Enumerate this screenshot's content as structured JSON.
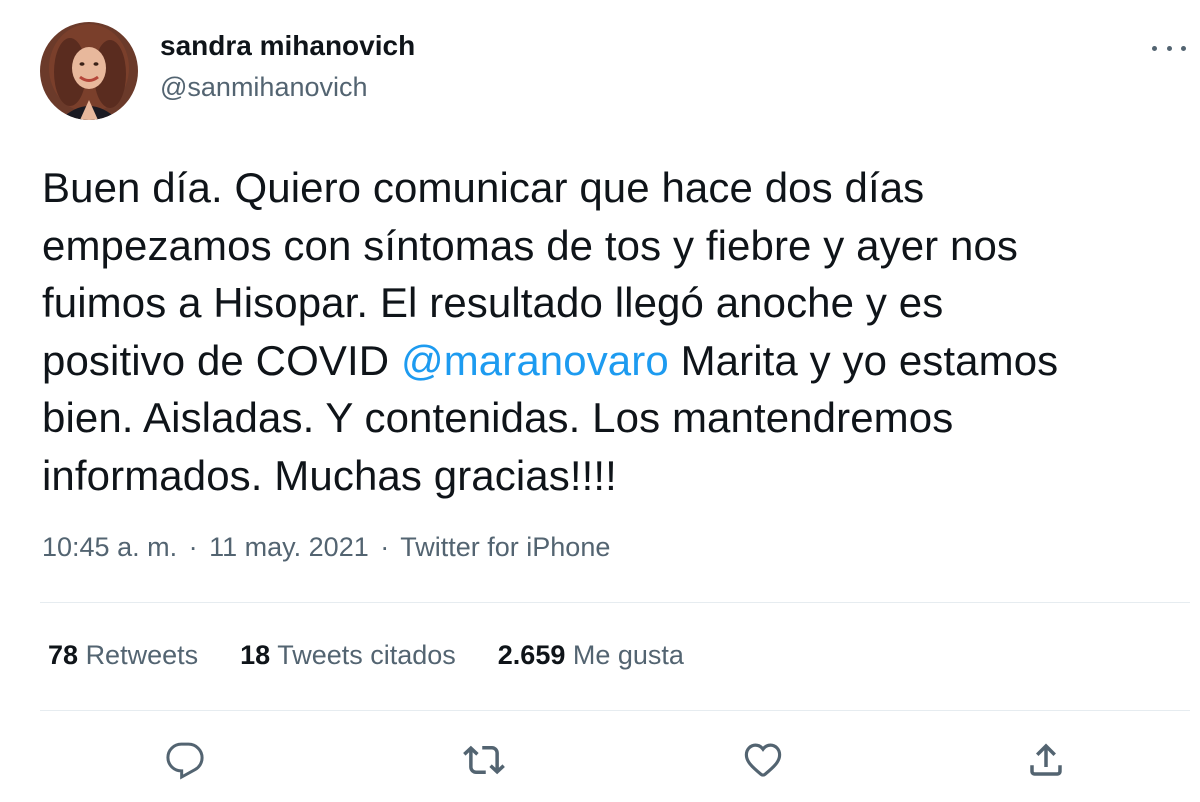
{
  "author": {
    "display_name": "sandra mihanovich",
    "handle": "@sanmihanovich",
    "avatar_icon": "profile-photo"
  },
  "tweet": {
    "lines": [
      "Buen día. Quiero comunicar que hace dos días",
      "empezamos con síntomas de tos y fiebre y ayer nos",
      "fuimos a Hisopar. El resultado llegó anoche y es",
      {
        "before": "positivo de COVID ",
        "mention": "@maranovaro",
        "after": " Marita y yo estamos"
      },
      "bien. Aisladas. Y contenidas. Los mantendremos",
      "informados. Muchas gracias!!!!"
    ]
  },
  "meta": {
    "time": "10:45 a. m.",
    "separator": "·",
    "date": "11 may. 2021",
    "source": "Twitter for iPhone"
  },
  "stats": {
    "retweets_count": "78",
    "retweets_label": "Retweets",
    "quotes_count": "18",
    "quotes_label": "Tweets citados",
    "likes_count": "2.659",
    "likes_label": "Me gusta"
  },
  "actions": [
    "reply-icon",
    "retweet-icon",
    "like-icon",
    "share-icon"
  ],
  "colors": {
    "text": "#0f1419",
    "secondary": "#536471",
    "link": "#1d9bf0",
    "divider": "#e6ecf0"
  }
}
